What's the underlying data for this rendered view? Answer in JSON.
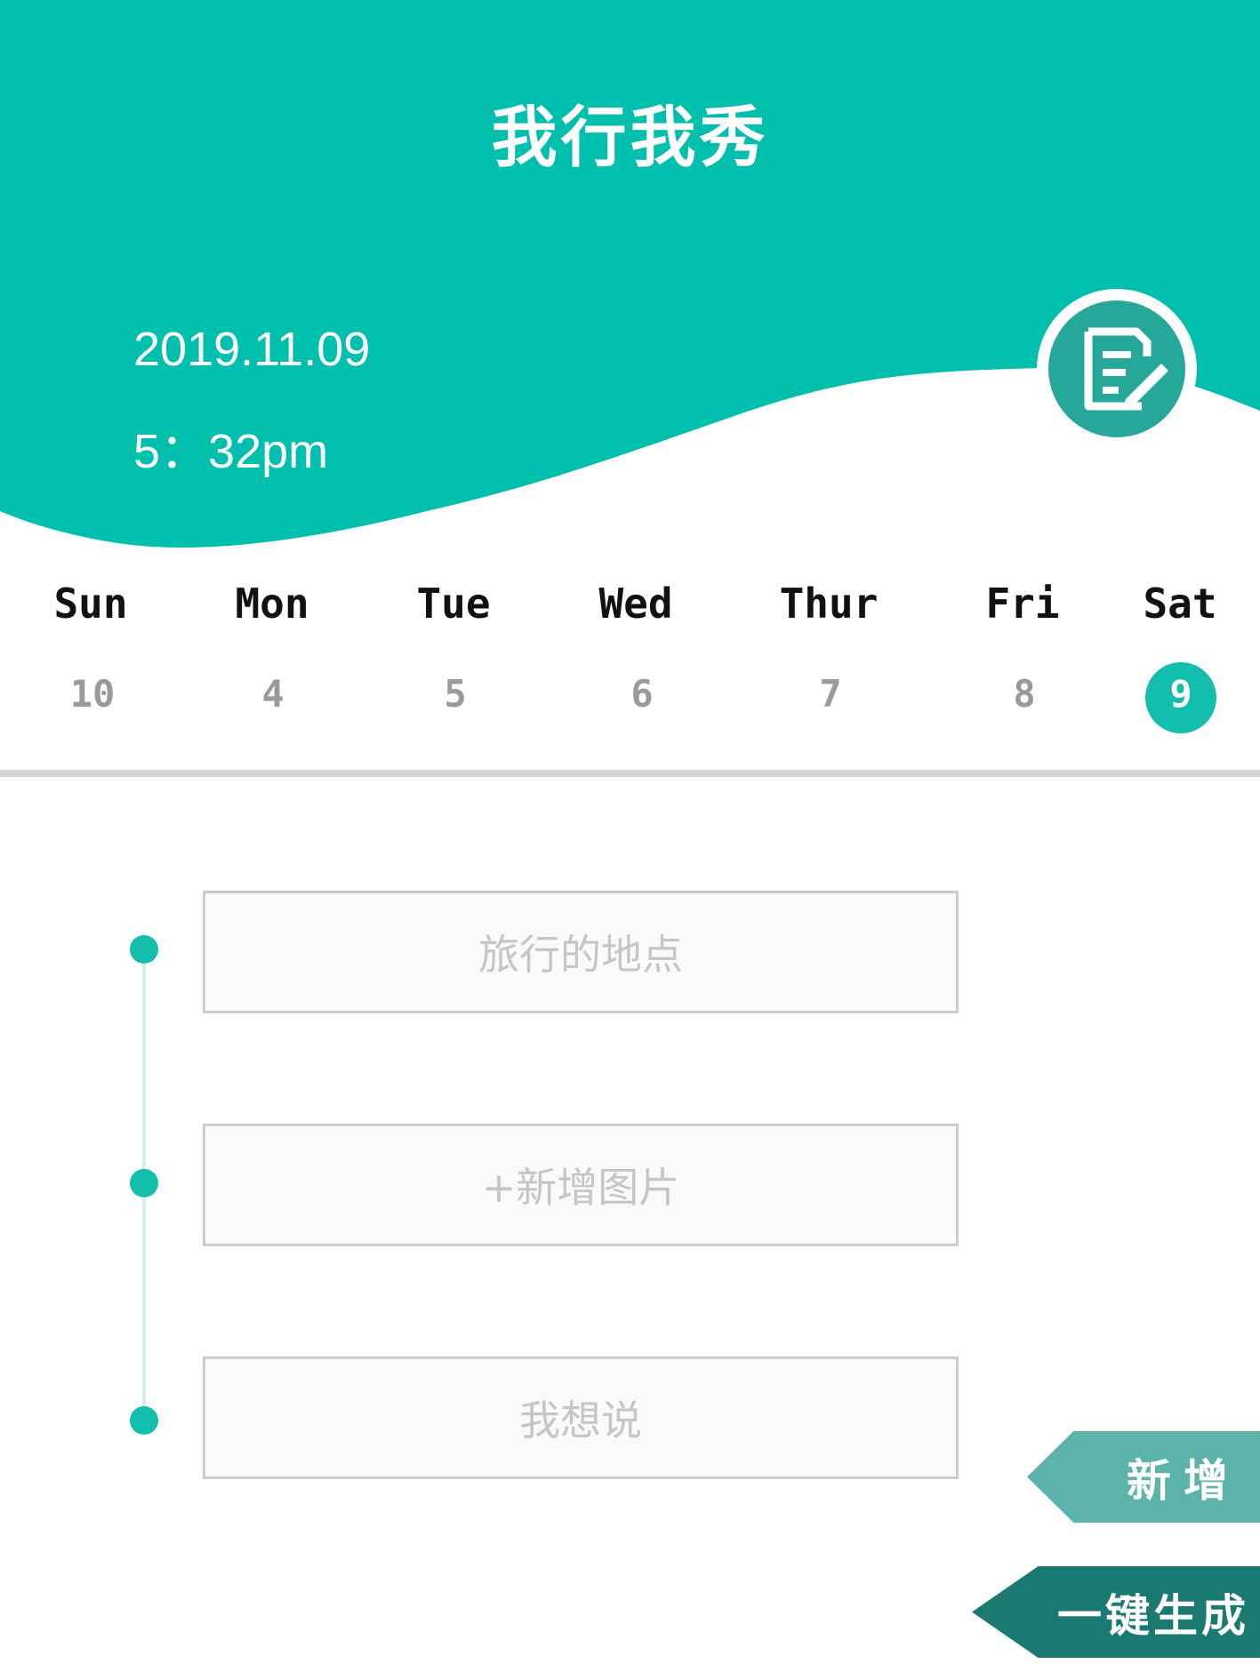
{
  "header": {
    "title": "我行我秀",
    "date": "2019.11.09",
    "time": "5：32pm",
    "edit_icon": "edit-note-icon",
    "bg_color": "#00bfac"
  },
  "calendar": {
    "weekdays": [
      "Sun",
      "Mon",
      "Tue",
      "Wed",
      "Thur",
      "Fri",
      "Sat"
    ],
    "dates": [
      "10",
      "4",
      "5",
      "6",
      "7",
      "8",
      "9"
    ],
    "selected_index": 6,
    "selected_color": "#12bfae"
  },
  "form": {
    "fields": [
      {
        "placeholder": "旅行的地点"
      },
      {
        "placeholder": "+新增图片"
      },
      {
        "placeholder": "我想说"
      }
    ]
  },
  "actions": {
    "add_label": "新增",
    "generate_label": "一键生成"
  }
}
